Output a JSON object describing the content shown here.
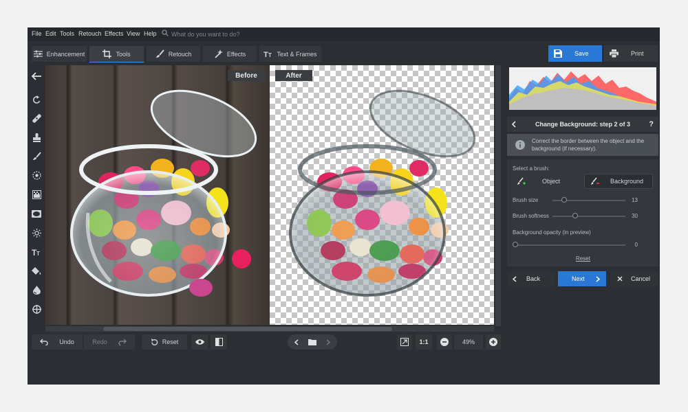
{
  "menu": {
    "items": [
      "File",
      "Edit",
      "Tools",
      "Retouch",
      "Effects",
      "View",
      "Help"
    ],
    "search_placeholder": "What do you want to do?"
  },
  "tabs": [
    {
      "label": "Enhancement",
      "icon": "sliders-icon"
    },
    {
      "label": "Tools",
      "icon": "crop-icon",
      "active": true
    },
    {
      "label": "Retouch",
      "icon": "brush-icon"
    },
    {
      "label": "Effects",
      "icon": "wand-icon"
    },
    {
      "label": "Text & Frames",
      "icon": "text-icon"
    }
  ],
  "actions": {
    "save_label": "Save",
    "print_label": "Print",
    "accent": "#2a78d6"
  },
  "left_tools": [
    "back-arrow-icon",
    "rotate-icon",
    "healing-icon",
    "stamp-icon",
    "brush-icon",
    "focus-icon",
    "gradient-icon",
    "vignette-icon",
    "brightness-icon",
    "text-icon",
    "fill-icon",
    "replace-color-icon",
    "target-icon"
  ],
  "preview": {
    "before_label": "Before",
    "after_label": "After"
  },
  "bottom": {
    "undo_label": "Undo",
    "redo_label": "Redo",
    "reset_label": "Reset",
    "fit_label": "1:1",
    "zoom": "49%"
  },
  "panel": {
    "step_title": "Change Background: step 2 of 3",
    "help": "?",
    "info_text": "Correct the border between the object and the background (if necessary).",
    "select_brush_label": "Select a brush:",
    "object_label": "Object",
    "background_label": "Background",
    "brush_size_label": "Brush size",
    "brush_size_value": "13",
    "brush_size_fraction": 0.13,
    "brush_softness_label": "Brush softness",
    "brush_softness_value": "30",
    "brush_softness_fraction": 0.3,
    "bg_opacity_label": "Background opacity (in preview)",
    "bg_opacity_value": "0",
    "bg_opacity_fraction": 0,
    "reset_link": "Reset",
    "back_label": "Back",
    "next_label": "Next",
    "cancel_label": "Cancel"
  }
}
